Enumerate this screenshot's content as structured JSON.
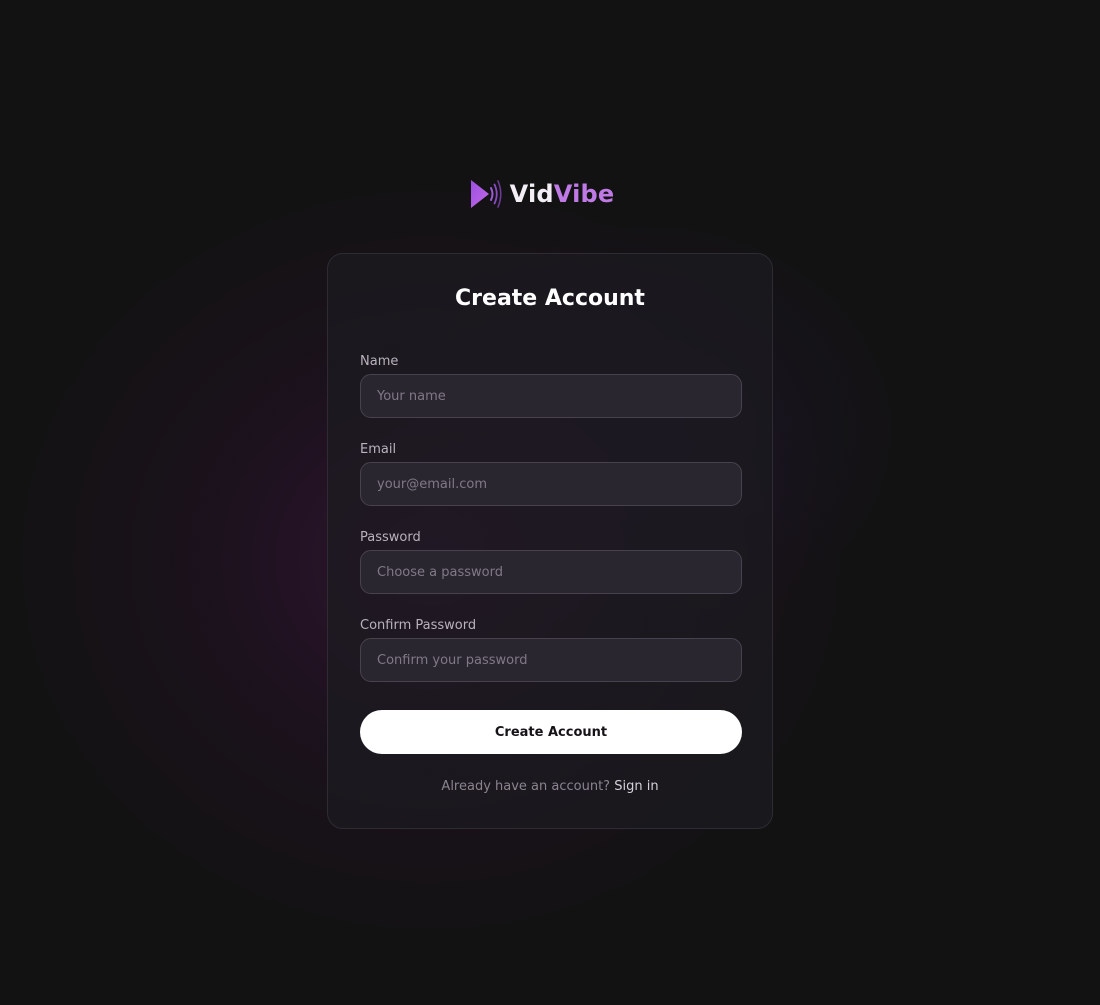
{
  "brand": {
    "name_part1": "Vid",
    "name_part2": "Vibe",
    "icon": "play-sound-icon",
    "accent_color": "#c07ae6"
  },
  "form": {
    "title": "Create Account",
    "fields": [
      {
        "label": "Name",
        "value": "",
        "placeholder": "Your name"
      },
      {
        "label": "Email",
        "value": "",
        "placeholder": "your@email.com"
      },
      {
        "label": "Password",
        "value": "",
        "placeholder": "Choose a password"
      },
      {
        "label": "Confirm Password",
        "value": "",
        "placeholder": "Confirm your password"
      }
    ],
    "submit_label": "Create Account",
    "signin_prompt": "Already have an account?",
    "signin_link": "Sign in"
  },
  "colors": {
    "background": "#131213",
    "button_bg": "#ffffff",
    "button_text": "#151316"
  }
}
